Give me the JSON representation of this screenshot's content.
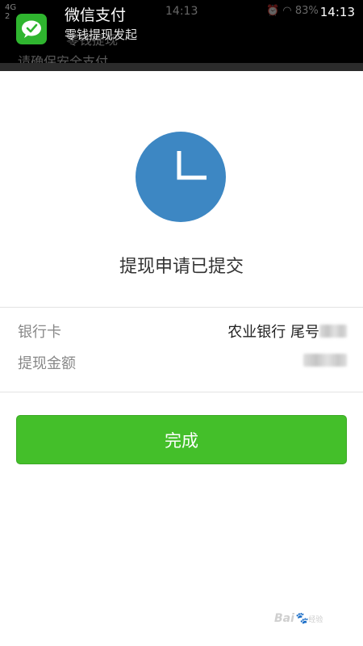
{
  "status_bar": {
    "network": "4G",
    "time": "14:13",
    "battery": "83%"
  },
  "notification": {
    "app_icon": "wechat-icon",
    "title": "微信支付",
    "subtitle": "零钱提现发起"
  },
  "result": {
    "icon": "clock-icon",
    "icon_color": "#3d87c3",
    "title": "提现申请已提交"
  },
  "details": [
    {
      "label": "银行卡",
      "value": "农业银行 尾号"
    },
    {
      "label": "提现金额",
      "value": ""
    }
  ],
  "actions": {
    "done_label": "完成",
    "done_color": "#44bf2a"
  },
  "watermark": {
    "brand": "Bai",
    "sub": "经验"
  }
}
